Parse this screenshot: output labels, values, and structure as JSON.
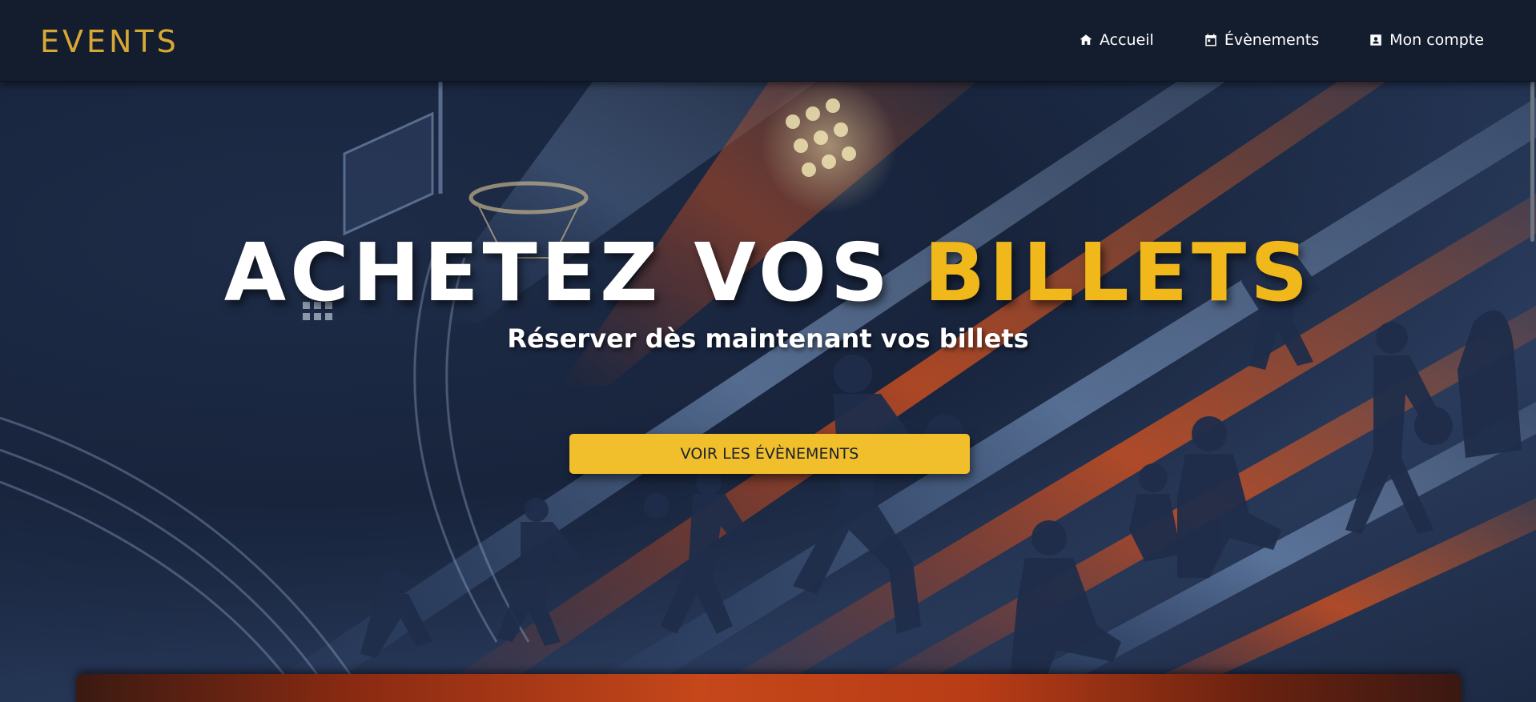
{
  "brand": "EVENTS",
  "nav": {
    "items": [
      {
        "label": "Accueil",
        "icon": "home-icon"
      },
      {
        "label": "Évènements",
        "icon": "calendar-icon"
      },
      {
        "label": "Mon compte",
        "icon": "user-card-icon"
      }
    ]
  },
  "hero": {
    "headline_main": "ACHETEZ VOS ",
    "headline_accent": "BILLETS",
    "subtitle": "Réserver dès maintenant vos billets",
    "cta_label": "VOIR LES ÉVÈNEMENTS"
  },
  "colors": {
    "navbar": "#141d2e",
    "brand": "#d8a835",
    "accent": "#f0b81a",
    "cta": "#f0bf2b"
  }
}
